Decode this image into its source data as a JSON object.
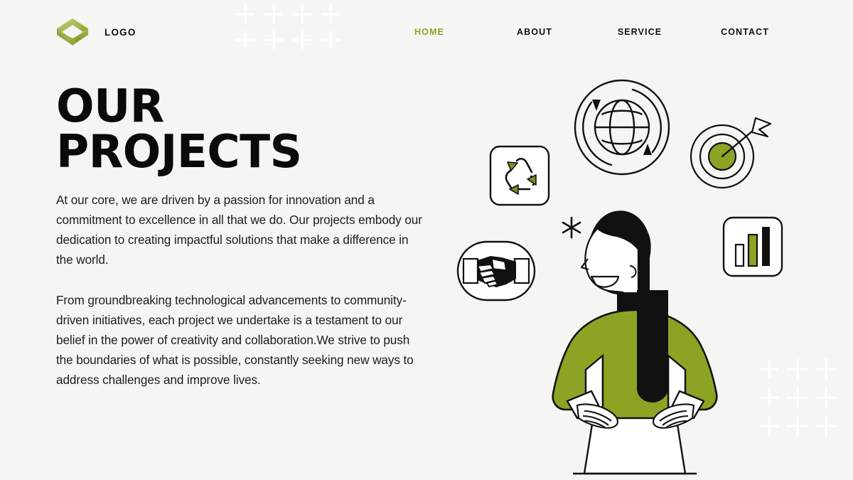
{
  "theme": {
    "background": "#f5f5f3",
    "accent_green": "#8ba423",
    "ink": "#111111",
    "decor_plus": "#ffffff"
  },
  "header": {
    "logo": {
      "icon": "isometric-cube-logo-icon",
      "label": "LOGO"
    },
    "nav": [
      {
        "label": "HOME",
        "active": true
      },
      {
        "label": "ABOUT",
        "active": false
      },
      {
        "label": "SERVICE",
        "active": false
      },
      {
        "label": "CONTACT",
        "active": false
      }
    ]
  },
  "hero": {
    "title": "OUR PROJECTS",
    "paragraphs": [
      "At our core, we are driven by a passion for innovation and a commitment to excellence in all that we do. Our projects embody our dedication to creating impactful solutions that make a difference in the world.",
      "From groundbreaking technological advancements to community-driven initiatives, each project we undertake is a testament to our belief in the power of creativity and collaboration.We strive to push the boundaries of what is possible, constantly seeking new ways to address challenges and improve lives."
    ]
  },
  "illustration": {
    "figure": "woman-hands-on-hips-illustration",
    "icons": [
      {
        "name": "globe-rotation-icon",
        "description": "globe with circular arrows"
      },
      {
        "name": "target-arrow-icon",
        "description": "dartboard with arrow in bullseye"
      },
      {
        "name": "recycle-icon",
        "description": "three recycling arrows in rounded square"
      },
      {
        "name": "handshake-icon",
        "description": "handshake inside rounded oval"
      },
      {
        "name": "bar-chart-icon",
        "description": "three ascending bars in rounded square"
      },
      {
        "name": "asterisk-icon",
        "description": "six-point asterisk sparkle"
      }
    ]
  },
  "decorations": {
    "plus_grid_top": {
      "columns": 4,
      "rows": 2
    },
    "plus_grid_bottom": {
      "columns": 3,
      "rows": 3
    }
  }
}
